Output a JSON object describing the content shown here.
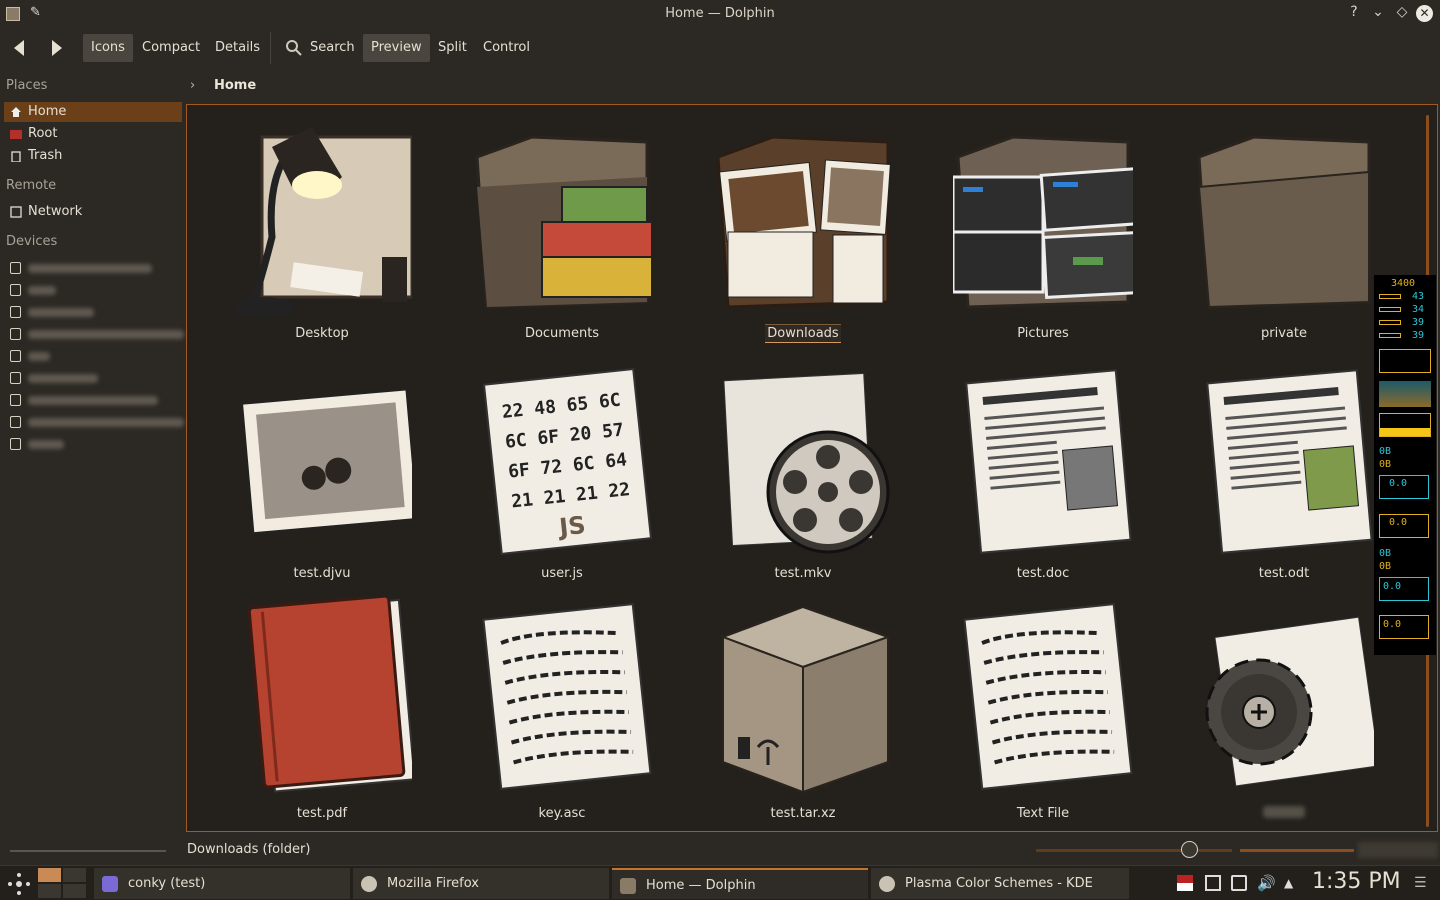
{
  "window": {
    "title": "Home — Dolphin",
    "help_btn": "?",
    "min_btn": "⌄",
    "max_btn": "◇",
    "close_btn": "✕"
  },
  "toolbar": {
    "icons": "Icons",
    "compact": "Compact",
    "details": "Details",
    "search": "Search",
    "preview": "Preview",
    "split": "Split",
    "control": "Control"
  },
  "sidebar": {
    "places_header": "Places",
    "places": [
      {
        "label": "Home",
        "icon": "home-icon"
      },
      {
        "label": "Root",
        "icon": "root-folder-icon"
      },
      {
        "label": "Trash",
        "icon": "trash-icon"
      }
    ],
    "remote_header": "Remote",
    "remote": [
      {
        "label": "Network",
        "icon": "network-icon"
      }
    ],
    "devices_header": "Devices"
  },
  "breadcrumb": {
    "current": "Home"
  },
  "files": [
    {
      "name": "Desktop",
      "icon": "desktop-folder-icon"
    },
    {
      "name": "Documents",
      "icon": "documents-folder-icon"
    },
    {
      "name": "Downloads",
      "icon": "downloads-folder-icon"
    },
    {
      "name": "Pictures",
      "icon": "pictures-folder-icon"
    },
    {
      "name": "private",
      "icon": "folder-icon"
    },
    {
      "name": "test.djvu",
      "icon": "image-file-icon"
    },
    {
      "name": "user.js",
      "icon": "javascript-file-icon"
    },
    {
      "name": "test.mkv",
      "icon": "video-file-icon"
    },
    {
      "name": "test.doc",
      "icon": "document-file-icon"
    },
    {
      "name": "test.odt",
      "icon": "document-file-icon"
    },
    {
      "name": "test.pdf",
      "icon": "pdf-book-icon"
    },
    {
      "name": "key.asc",
      "icon": "text-file-icon"
    },
    {
      "name": "test.tar.xz",
      "icon": "archive-box-icon"
    },
    {
      "name": "Text File",
      "icon": "text-file-icon"
    },
    {
      "name": "",
      "icon": "executable-gear-icon"
    }
  ],
  "selected_file": "Downloads",
  "status": {
    "text": "Downloads (folder)"
  },
  "conky": {
    "cpu_freq": "3400",
    "cores": [
      "43",
      "34",
      "39",
      "39"
    ],
    "net1_down": "0B",
    "net1_up": "0B",
    "net1_graph_a": "0.0",
    "net1_graph_b": "0.0",
    "net2_down": "0B",
    "net2_up": "0B",
    "net2_graph_a": "0.0",
    "net2_graph_b": "0.0"
  },
  "taskbar": {
    "tasks": [
      "conky (test)",
      "Mozilla Firefox",
      "Home — Dolphin",
      "Plasma Color Schemes - KDE Store..."
    ],
    "clock": "1:35 PM"
  },
  "colors": {
    "accent": "#c4752b",
    "selection": "#6b3f18",
    "background": "#2c2924",
    "view_background": "#24211d"
  }
}
